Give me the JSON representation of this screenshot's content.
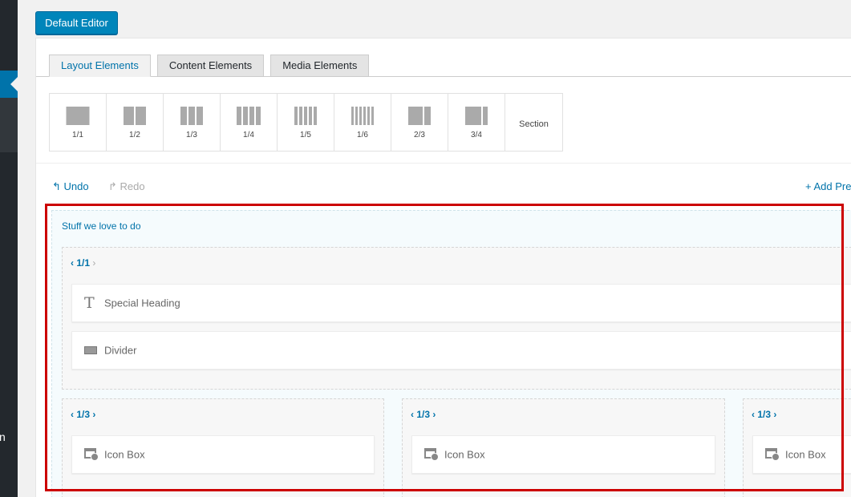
{
  "sidebar": {
    "cut_label": "n"
  },
  "header": {
    "default_editor_label": "Default Editor"
  },
  "tabs": [
    {
      "label": "Layout Elements",
      "active": true
    },
    {
      "label": "Content Elements",
      "active": false
    },
    {
      "label": "Media Elements",
      "active": false
    }
  ],
  "layout_elements": [
    {
      "label": "1/1",
      "icon": "column-1-1-icon"
    },
    {
      "label": "1/2",
      "icon": "column-1-2-icon"
    },
    {
      "label": "1/3",
      "icon": "column-1-3-icon"
    },
    {
      "label": "1/4",
      "icon": "column-1-4-icon"
    },
    {
      "label": "1/5",
      "icon": "column-1-5-icon"
    },
    {
      "label": "1/6",
      "icon": "column-1-6-icon"
    },
    {
      "label": "2/3",
      "icon": "column-2-3-icon"
    },
    {
      "label": "3/4",
      "icon": "column-3-4-icon"
    },
    {
      "label": "Section",
      "icon": ""
    }
  ],
  "toolbar": {
    "undo_label": "Undo",
    "redo_label": "Redo",
    "add_preset_label": "Add Pre"
  },
  "builder": {
    "section_title": "Stuff we love to do",
    "row1": {
      "column_size": "1/1",
      "elements": [
        {
          "label": "Special Heading",
          "icon": "text-icon"
        },
        {
          "label": "Divider",
          "icon": "divider-icon"
        }
      ]
    },
    "row2": [
      {
        "column_size": "1/3",
        "element_label": "Icon Box",
        "icon": "icon-box-icon"
      },
      {
        "column_size": "1/3",
        "element_label": "Icon Box",
        "icon": "icon-box-icon"
      },
      {
        "column_size": "1/3",
        "element_label": "Icon Box",
        "icon": "icon-box-icon"
      }
    ]
  },
  "colors": {
    "accent": "#0073aa",
    "highlight": "#cc0000",
    "admin_bar": "#23282d"
  }
}
